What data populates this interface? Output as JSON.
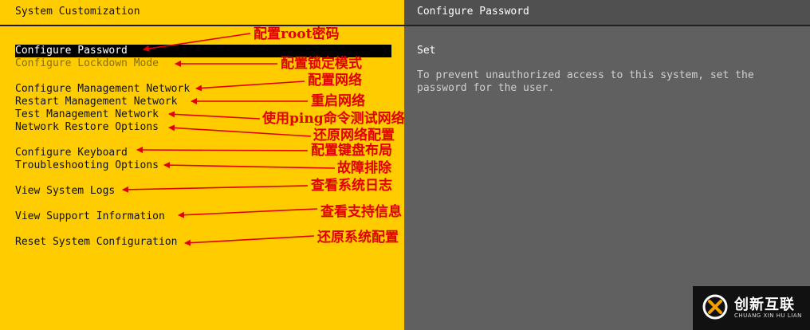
{
  "left_panel": {
    "title": "System Customization",
    "menu": [
      {
        "label": "Configure Password",
        "state": "selected"
      },
      {
        "label": "Configure Lockdown Mode",
        "state": "disabled"
      },
      {
        "label": "Configure Management Network",
        "state": "normal"
      },
      {
        "label": "Restart Management Network",
        "state": "normal"
      },
      {
        "label": "Test Management Network",
        "state": "normal"
      },
      {
        "label": "Network Restore Options",
        "state": "normal"
      },
      {
        "label": "Configure Keyboard",
        "state": "normal"
      },
      {
        "label": "Troubleshooting Options",
        "state": "normal"
      },
      {
        "label": "View System Logs",
        "state": "normal"
      },
      {
        "label": "View Support Information",
        "state": "normal"
      },
      {
        "label": "Reset System Configuration",
        "state": "normal"
      }
    ]
  },
  "right_panel": {
    "title": "Configure Password",
    "status": "Set",
    "description": "To prevent unauthorized access to this system, set the\npassword for the user."
  },
  "annotations": [
    "配置root密码",
    "配置锁定模式",
    "配置网络",
    "重启网络",
    "使用ping命令测试网络",
    "还原网络配置",
    "配置键盘布局",
    "故障排除",
    "查看系统日志",
    "查看支持信息",
    "还原系统配置"
  ],
  "watermark": {
    "name": "创新互联",
    "subtitle": "CHUANG XIN HU LIAN"
  },
  "colors": {
    "left_bg": "#ffcc00",
    "right_bg": "#606060",
    "annotation": "#e00000"
  }
}
